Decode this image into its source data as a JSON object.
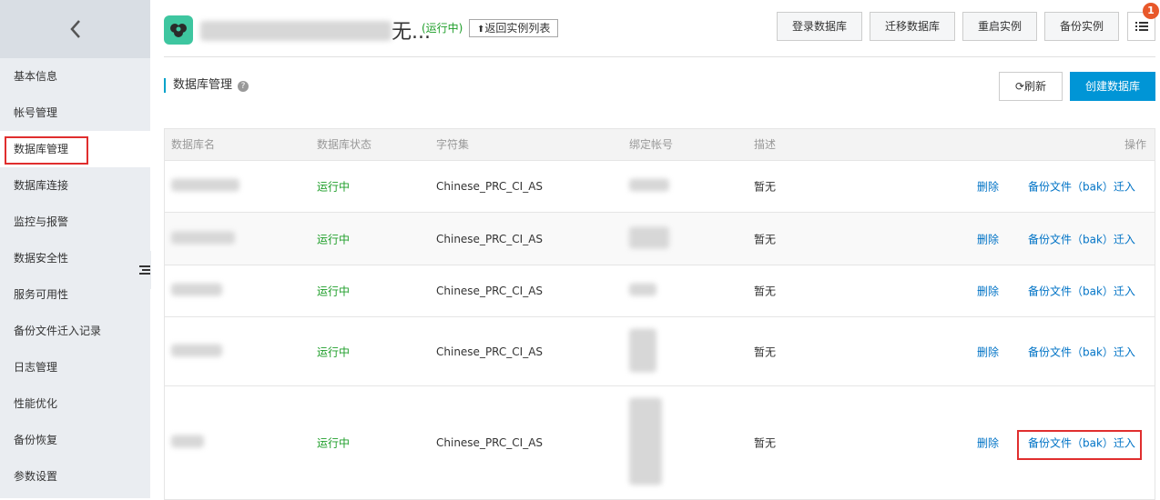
{
  "sidebar": {
    "items": [
      {
        "label": "基本信息"
      },
      {
        "label": "帐号管理"
      },
      {
        "label": "数据库管理"
      },
      {
        "label": "数据库连接"
      },
      {
        "label": "监控与报警"
      },
      {
        "label": "数据安全性"
      },
      {
        "label": "服务可用性"
      },
      {
        "label": "备份文件迁入记录"
      },
      {
        "label": "日志管理"
      },
      {
        "label": "性能优化"
      },
      {
        "label": "备份恢复"
      },
      {
        "label": "参数设置"
      }
    ],
    "active_index": 2
  },
  "header": {
    "title_suffix": "无...",
    "status": "(运行中)",
    "back_button": "返回实例列表",
    "buttons": [
      "登录数据库",
      "迁移数据库",
      "重启实例",
      "备份实例"
    ],
    "badge_count": "1"
  },
  "section": {
    "title": "数据库管理",
    "help_icon": "?",
    "refresh_button": "刷新",
    "create_button": "创建数据库"
  },
  "table": {
    "columns": [
      "数据库名",
      "数据库状态",
      "字符集",
      "绑定帐号",
      "描述",
      "操作"
    ],
    "rows": [
      {
        "status": "运行中",
        "charset": "Chinese_PRC_CI_AS",
        "desc": "暂无",
        "delete": "删除",
        "migrate": "备份文件（bak）迁入"
      },
      {
        "status": "运行中",
        "charset": "Chinese_PRC_CI_AS",
        "desc": "暂无",
        "delete": "删除",
        "migrate": "备份文件（bak）迁入"
      },
      {
        "status": "运行中",
        "charset": "Chinese_PRC_CI_AS",
        "desc": "暂无",
        "delete": "删除",
        "migrate": "备份文件（bak）迁入"
      },
      {
        "status": "运行中",
        "charset": "Chinese_PRC_CI_AS",
        "desc": "暂无",
        "delete": "删除",
        "migrate": "备份文件（bak）迁入"
      },
      {
        "status": "运行中",
        "charset": "Chinese_PRC_CI_AS",
        "desc": "暂无",
        "delete": "删除",
        "migrate": "备份文件（bak）迁入"
      }
    ]
  },
  "colors": {
    "accent": "#0095d6",
    "running": "#1e9e29",
    "link": "#0073c6",
    "highlight": "#e02e2e",
    "badge": "#e8582a"
  }
}
